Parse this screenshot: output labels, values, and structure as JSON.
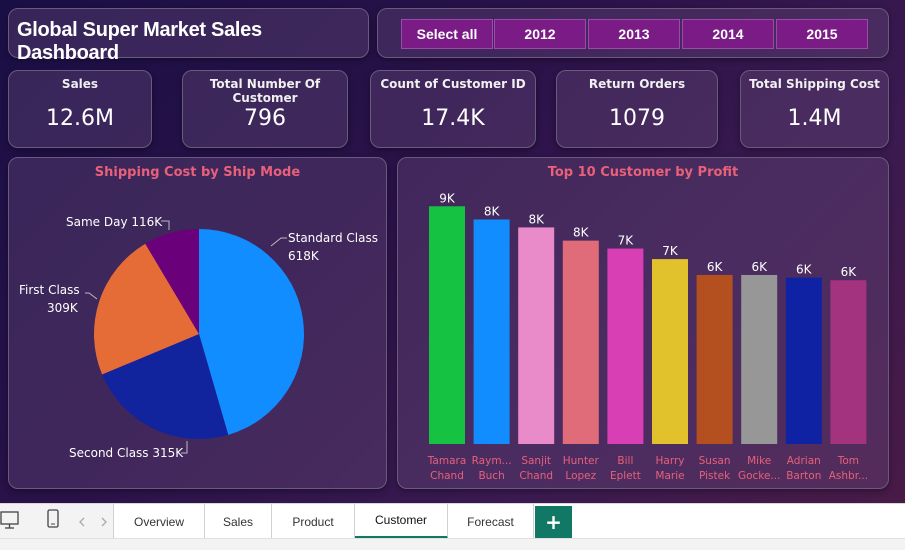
{
  "title": "Global Super Market Sales Dashboard",
  "slicer": {
    "options": [
      "Select all",
      "2012",
      "2013",
      "2014",
      "2015"
    ]
  },
  "kpis": [
    {
      "label": "Sales",
      "value": "12.6M"
    },
    {
      "label": "Total Number Of Customer",
      "value": "796"
    },
    {
      "label": "Count of Customer ID",
      "value": "17.4K"
    },
    {
      "label": "Return Orders",
      "value": "1079"
    },
    {
      "label": "Total Shipping Cost",
      "value": "1.4M"
    }
  ],
  "pie": {
    "title": "Shipping Cost by Ship Mode",
    "labels": {
      "standard_name": "Standard Class",
      "standard_value": "618K",
      "second": "Second Class 315K",
      "first_name": "First Class",
      "first_value": "309K",
      "sameday": "Same Day 116K"
    }
  },
  "bar": {
    "title": "Top 10 Customer by Profit",
    "name_lines": [
      [
        "Tamara",
        "Chand"
      ],
      [
        "Raym...",
        "Buch"
      ],
      [
        "Sanjit",
        "Chand"
      ],
      [
        "Hunter",
        "Lopez"
      ],
      [
        "Bill",
        "Eplett"
      ],
      [
        "Harry",
        "Marie"
      ],
      [
        "Susan",
        "Pistek"
      ],
      [
        "Mike",
        "Gocke..."
      ],
      [
        "Adrian",
        "Barton"
      ],
      [
        "Tom",
        "Ashbr..."
      ]
    ]
  },
  "chart_data": [
    {
      "type": "pie",
      "title": "Shipping Cost by Ship Mode",
      "categories": [
        "Standard Class",
        "Second Class",
        "First Class",
        "Same Day"
      ],
      "values": [
        618,
        315,
        309,
        116
      ],
      "value_labels": [
        "618K",
        "315K",
        "309K",
        "116K"
      ],
      "colors": [
        "#118dff",
        "#12239e",
        "#e66c37",
        "#6b007b"
      ]
    },
    {
      "type": "bar",
      "title": "Top 10 Customer by Profit",
      "categories": [
        "Tamara Chand",
        "Raym... Buch",
        "Sanjit Chand",
        "Hunter Lopez",
        "Bill Eplett",
        "Harry Marie",
        "Susan Pistek",
        "Mike Gocke...",
        "Adrian Barton",
        "Tom Ashbr..."
      ],
      "values": [
        9.0,
        8.5,
        8.2,
        7.7,
        7.4,
        7.0,
        6.4,
        6.4,
        6.3,
        6.2
      ],
      "value_labels": [
        "9K",
        "8K",
        "8K",
        "8K",
        "7K",
        "7K",
        "6K",
        "6K",
        "6K",
        "6K"
      ],
      "colors": [
        "#15c242",
        "#118dff",
        "#e98bc9",
        "#e06b79",
        "#d93fb5",
        "#e2c22c",
        "#b4501f",
        "#979797",
        "#0f22a4",
        "#a4337f"
      ],
      "ylim": [
        0,
        9.2
      ]
    }
  ],
  "tabs": [
    "Overview",
    "Sales",
    "Product",
    "Customer",
    "Forecast"
  ],
  "active_tab": "Customer",
  "add_label": "+",
  "icons": [
    "desktop-icon",
    "phone-icon",
    "chevron-left-icon",
    "chevron-right-icon"
  ],
  "colors": {
    "accent": "#117865",
    "slicer": "#7a1b86",
    "chart_title": "#e8607a"
  }
}
